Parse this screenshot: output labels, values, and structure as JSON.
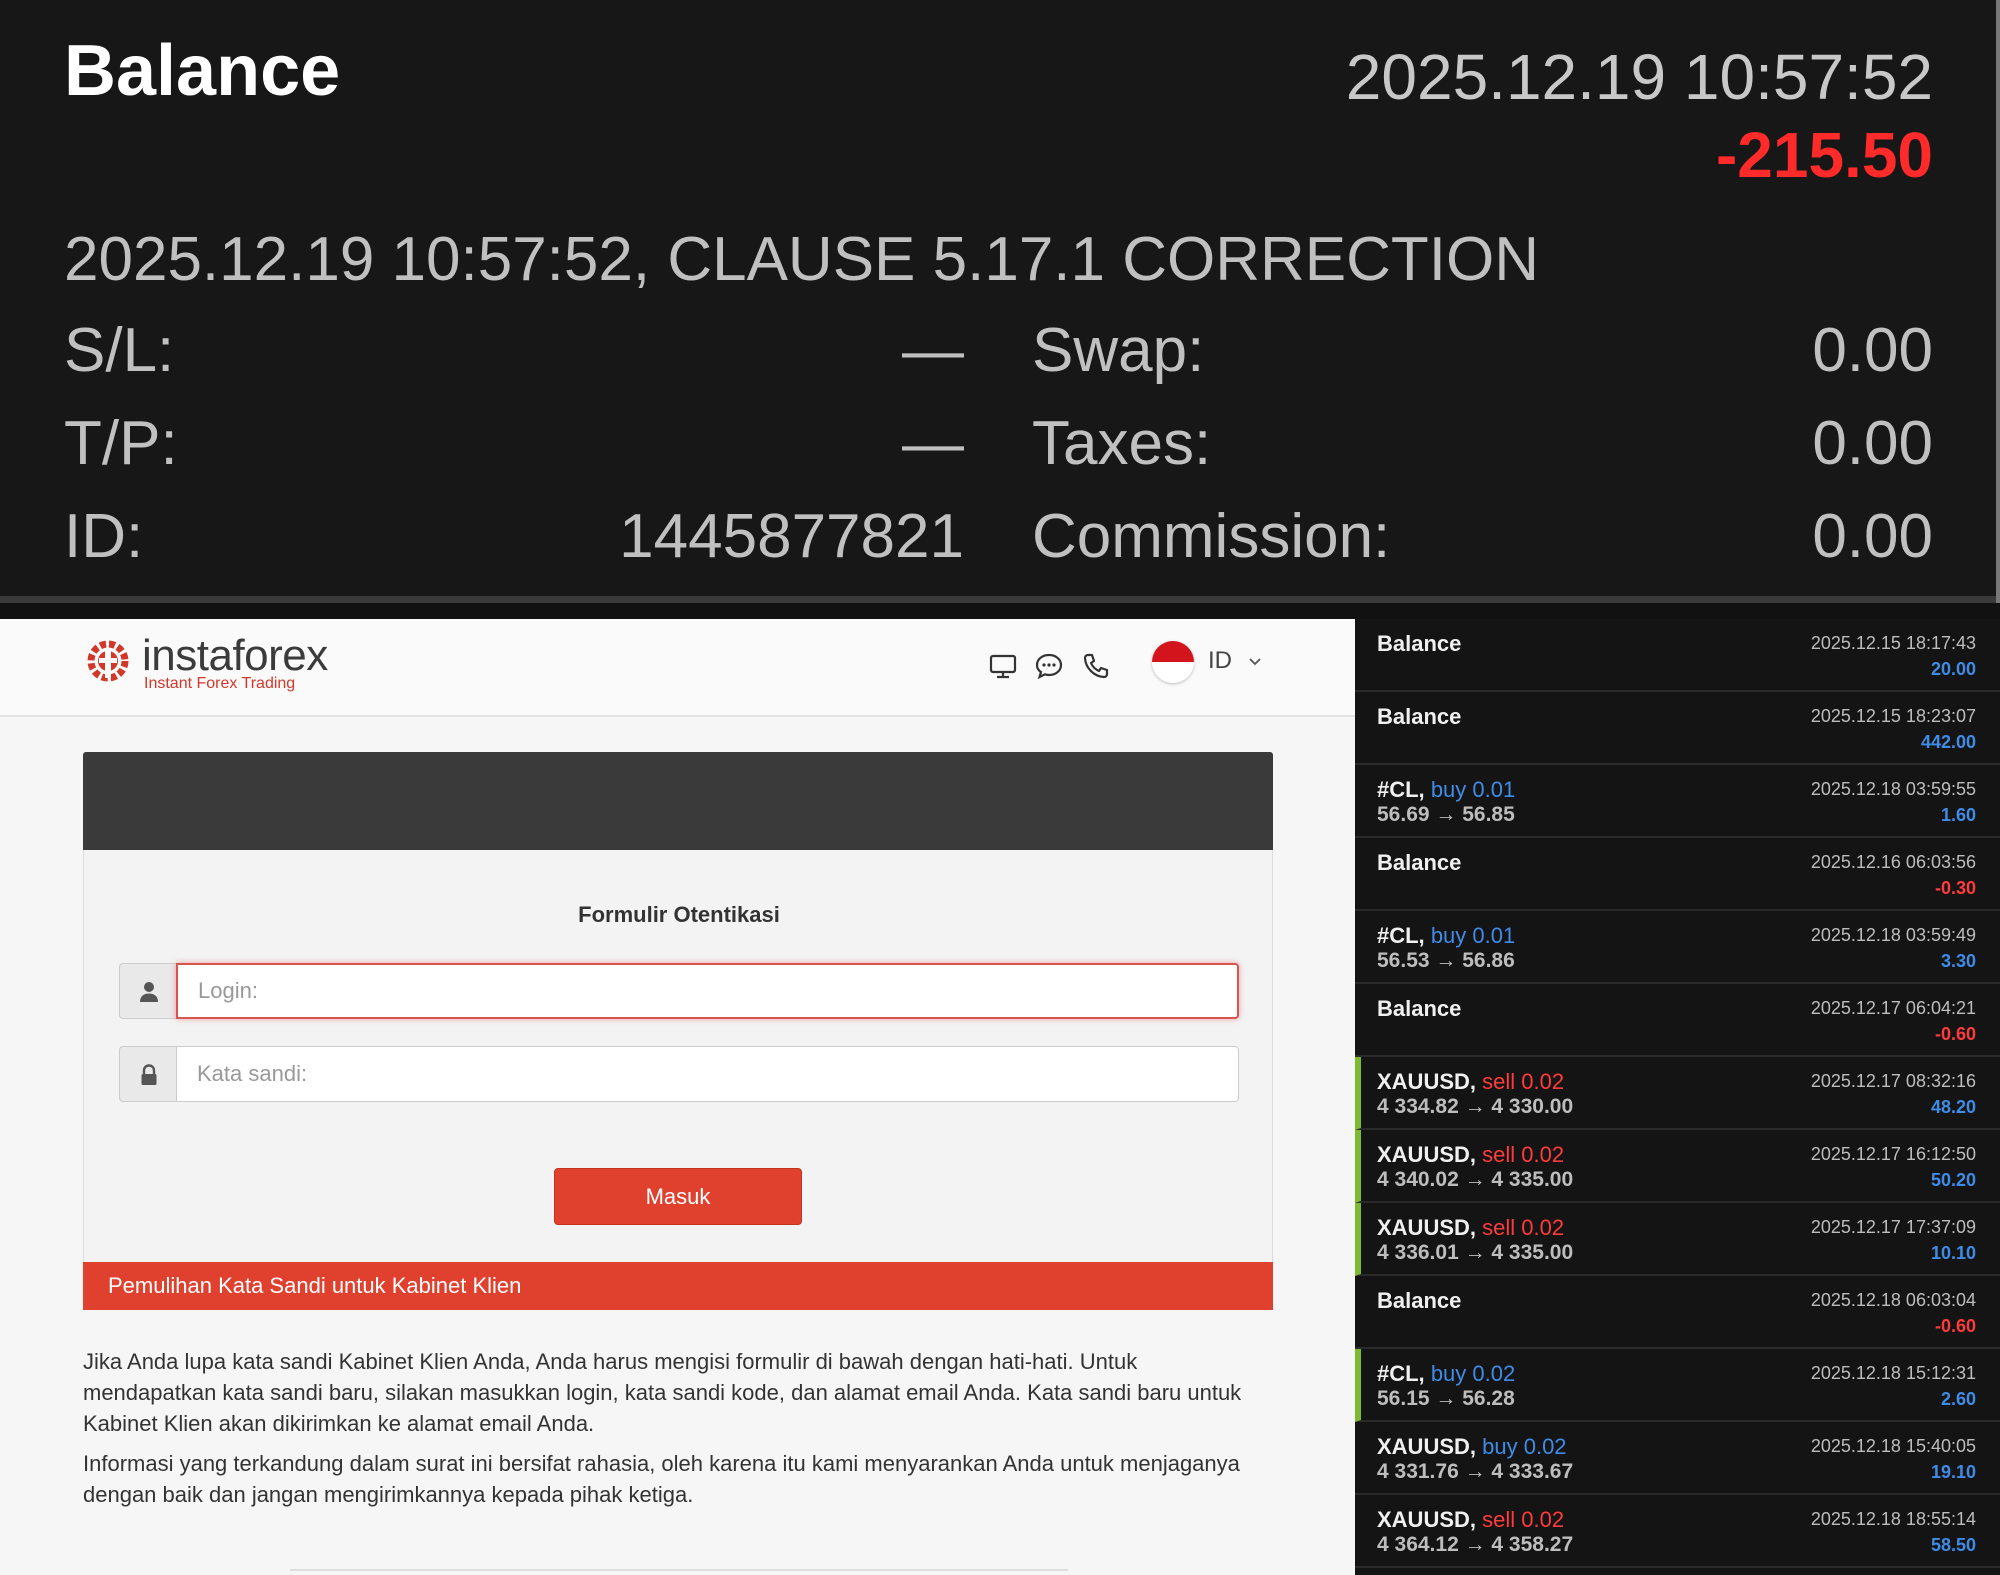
{
  "detail": {
    "title": "Balance",
    "time": "2025.12.19 10:57:52",
    "amount": "-215.50",
    "comment": "2025.12.19 10:57:52, CLAUSE 5.17.1 CORRECTION",
    "sl_label": "S/L:",
    "sl_value": "—",
    "tp_label": "T/P:",
    "tp_value": "—",
    "id_label": "ID:",
    "id_value": "1445877821",
    "swap_label": "Swap:",
    "swap_value": "0.00",
    "taxes_label": "Taxes:",
    "taxes_value": "0.00",
    "commission_label": "Commission:",
    "commission_value": "0.00",
    "amount_color": "#ff2a2a"
  },
  "insta": {
    "logo_name": "instaforex",
    "logo_tagline": "Instant Forex Trading",
    "header_icons": [
      "monitor-icon",
      "chat-icon",
      "phone-icon"
    ],
    "language": "ID",
    "form_title": "Formulir Otentikasi",
    "login_placeholder": "Login:",
    "password_placeholder": "Kata sandi:",
    "submit_label": "Masuk",
    "recovery_title": "Pemulihan Kata Sandi untuk Kabinet Klien",
    "paragraph1": "Jika Anda lupa kata sandi Kabinet Klien Anda, Anda harus mengisi formulir di bawah dengan hati-hati. Untuk mendapatkan kata sandi baru, silakan masukkan login, kata sandi kode, dan alamat email Anda. Kata sandi baru untuk Kabinet Klien akan dikirimkan ke alamat email Anda.",
    "paragraph2": "Informasi yang terkandung dalam surat ini bersifat rahasia, oleh karena itu kami menyarankan Anda untuk menjaganya dengan baik dan jangan mengirimkannya kepada pihak ketiga.",
    "brand_color": "#e0412f"
  },
  "history": [
    {
      "symbol": "Balance",
      "side": "",
      "price": "",
      "time": "2025.12.15 18:17:43",
      "profit": "20.00",
      "sign": "pos",
      "marked": false
    },
    {
      "symbol": "Balance",
      "side": "",
      "price": "",
      "time": "2025.12.15 18:23:07",
      "profit": "442.00",
      "sign": "pos",
      "marked": false
    },
    {
      "symbol": "#CL,",
      "side": "buy 0.01",
      "sideType": "buy",
      "price": "56.69 → 56.85",
      "time": "2025.12.18 03:59:55",
      "profit": "1.60",
      "sign": "pos",
      "marked": false
    },
    {
      "symbol": "Balance",
      "side": "",
      "price": "",
      "time": "2025.12.16 06:03:56",
      "profit": "-0.30",
      "sign": "neg",
      "marked": false
    },
    {
      "symbol": "#CL,",
      "side": "buy 0.01",
      "sideType": "buy",
      "price": "56.53 → 56.86",
      "time": "2025.12.18 03:59:49",
      "profit": "3.30",
      "sign": "pos",
      "marked": false
    },
    {
      "symbol": "Balance",
      "side": "",
      "price": "",
      "time": "2025.12.17 06:04:21",
      "profit": "-0.60",
      "sign": "neg",
      "marked": false
    },
    {
      "symbol": "XAUUSD,",
      "side": "sell 0.02",
      "sideType": "sell",
      "price": "4 334.82 → 4 330.00",
      "time": "2025.12.17 08:32:16",
      "profit": "48.20",
      "sign": "pos",
      "marked": true
    },
    {
      "symbol": "XAUUSD,",
      "side": "sell 0.02",
      "sideType": "sell",
      "price": "4 340.02 → 4 335.00",
      "time": "2025.12.17 16:12:50",
      "profit": "50.20",
      "sign": "pos",
      "marked": true
    },
    {
      "symbol": "XAUUSD,",
      "side": "sell 0.02",
      "sideType": "sell",
      "price": "4 336.01 → 4 335.00",
      "time": "2025.12.17 17:37:09",
      "profit": "10.10",
      "sign": "pos",
      "marked": true
    },
    {
      "symbol": "Balance",
      "side": "",
      "price": "",
      "time": "2025.12.18 06:03:04",
      "profit": "-0.60",
      "sign": "neg",
      "marked": false
    },
    {
      "symbol": "#CL,",
      "side": "buy 0.02",
      "sideType": "buy",
      "price": "56.15 → 56.28",
      "time": "2025.12.18 15:12:31",
      "profit": "2.60",
      "sign": "pos",
      "marked": true
    },
    {
      "symbol": "XAUUSD,",
      "side": "buy 0.02",
      "sideType": "buy",
      "price": "4 331.76 → 4 333.67",
      "time": "2025.12.18 15:40:05",
      "profit": "19.10",
      "sign": "pos",
      "marked": false
    },
    {
      "symbol": "XAUUSD,",
      "side": "sell 0.02",
      "sideType": "sell",
      "price": "4 364.12 → 4 358.27",
      "time": "2025.12.18 18:55:14",
      "profit": "58.50",
      "sign": "pos",
      "marked": false
    }
  ],
  "colors": {
    "buy": "#3f8ce8",
    "sell": "#ff3b3b",
    "marker": "#7fb832"
  }
}
